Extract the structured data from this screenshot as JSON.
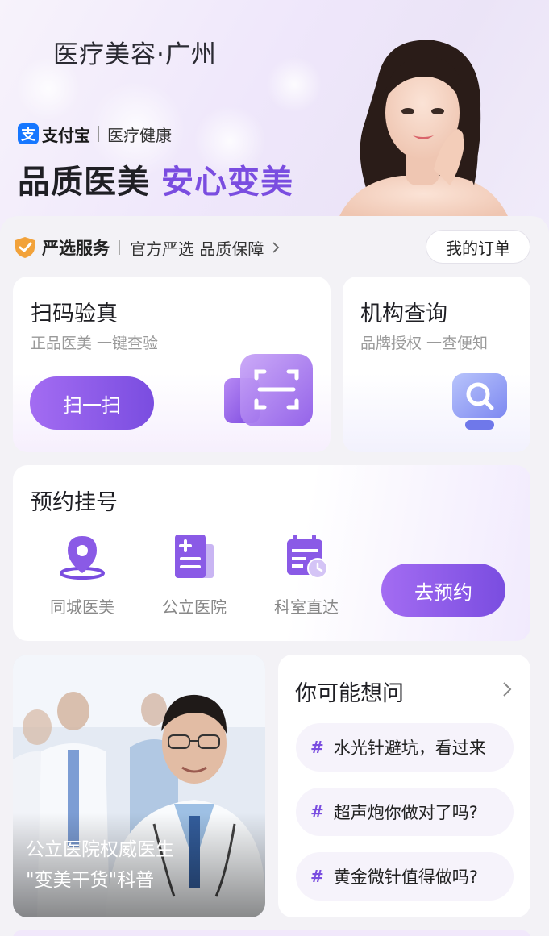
{
  "header": {
    "title": "医疗美容·广州",
    "brand_name": "支付宝",
    "brand_sub": "医疗健康",
    "slogan_part1": "品质医美",
    "slogan_part2": "安心变美"
  },
  "service_bar": {
    "title": "严选服务",
    "subtitle": "官方严选 品质保障",
    "order_button": "我的订单"
  },
  "scan_card": {
    "title": "扫码验真",
    "subtitle": "正品医美 一键查验",
    "button": "扫一扫"
  },
  "institution_card": {
    "title": "机构查询",
    "subtitle": "品牌授权 一查便知"
  },
  "appointment_card": {
    "title": "预约挂号",
    "items": [
      {
        "label": "同城医美",
        "icon": "location-pin-icon"
      },
      {
        "label": "公立医院",
        "icon": "hospital-document-icon"
      },
      {
        "label": "科室直达",
        "icon": "calendar-clock-icon"
      }
    ],
    "button": "去预约"
  },
  "doctor_banner": {
    "line1": "公立医院权威医生",
    "line2": "\"变美干货\"科普"
  },
  "faq_card": {
    "title": "你可能想问",
    "hash": "#",
    "questions": [
      "水光针避坑，看过来",
      "超声炮你做对了吗?",
      "黄金微针值得做吗?"
    ]
  },
  "colors": {
    "accent": "#7a4de0",
    "accent_light": "#a36cf2",
    "alipay_blue": "#1677ff",
    "shield_orange": "#f2a23a"
  }
}
